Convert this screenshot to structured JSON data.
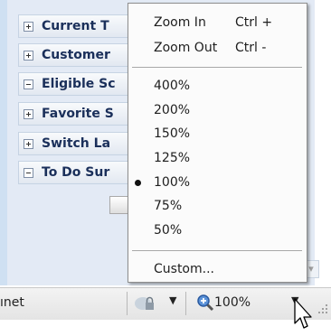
{
  "sidebar": {
    "items": [
      {
        "label": "Current T",
        "state": "plus"
      },
      {
        "label": "Customer",
        "state": "plus"
      },
      {
        "label": "Eligible Sc",
        "state": "minus"
      },
      {
        "label": "Favorite S",
        "state": "plus"
      },
      {
        "label": "Switch La",
        "state": "plus"
      },
      {
        "label": "To Do Sur",
        "state": "minus"
      }
    ]
  },
  "zoom_menu": {
    "zoom_in": {
      "label": "Zoom In",
      "shortcut": "Ctrl +"
    },
    "zoom_out": {
      "label": "Zoom Out",
      "shortcut": "Ctrl -"
    },
    "levels": [
      "400%",
      "200%",
      "150%",
      "125%",
      "100%",
      "75%",
      "50%"
    ],
    "selected": "100%",
    "custom": "Custom..."
  },
  "statusbar": {
    "zone_text": "ınet",
    "zoom_level": "100%"
  }
}
